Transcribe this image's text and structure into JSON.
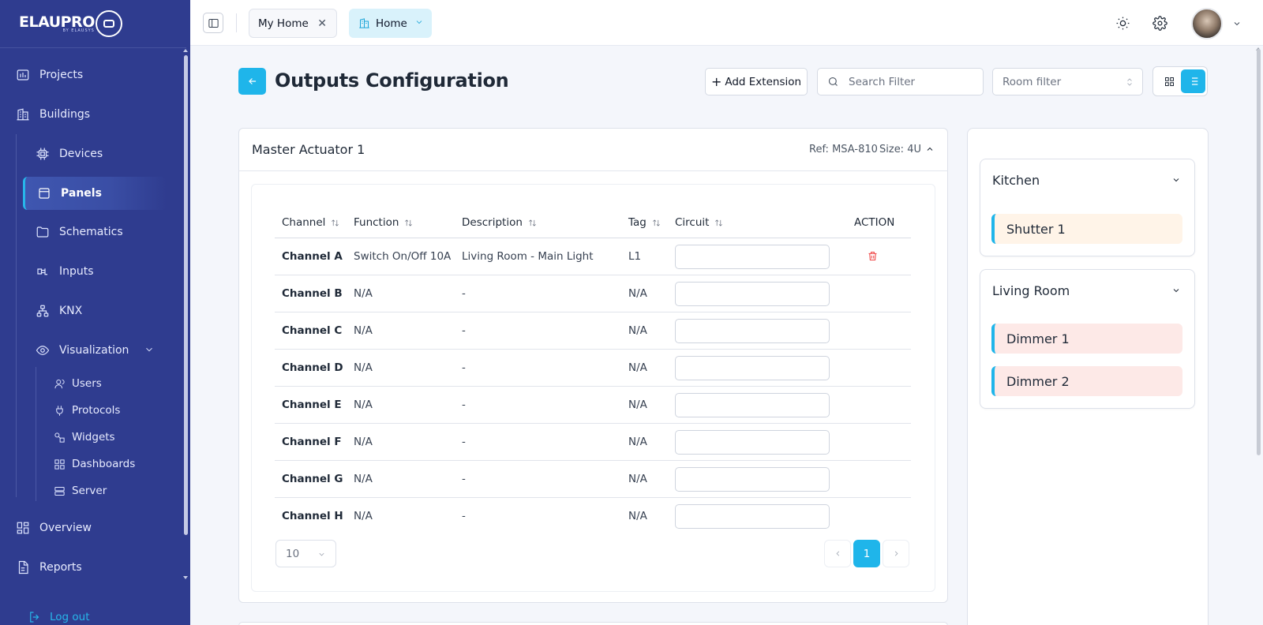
{
  "sidebar": {
    "logo": {
      "name": "ELAUPRO",
      "sub": "BY ELAUSYS"
    },
    "items": {
      "projects": "Projects",
      "buildings": "Buildings",
      "devices": "Devices",
      "panels": "Panels",
      "schematics": "Schematics",
      "inputs": "Inputs",
      "knx": "KNX",
      "visualization": "Visualization",
      "users": "Users",
      "protocols": "Protocols",
      "widgets": "Widgets",
      "dashboards": "Dashboards",
      "server": "Server",
      "overview": "Overview",
      "reports": "Reports"
    },
    "logout": "Log out",
    "active_item": "Panels"
  },
  "topbar": {
    "tabs": [
      {
        "label": "My Home",
        "closable": true
      },
      {
        "label": "Home",
        "icon": "building-icon",
        "dropdown": true
      }
    ]
  },
  "page": {
    "title": "Outputs Configuration",
    "add_extension": "Add Extension",
    "search_placeholder": "Search Filter",
    "room_filter_placeholder": "Room filter",
    "view_mode": "list"
  },
  "actuator": {
    "name": "Master Actuator 1",
    "ref": "Ref: MSA-810",
    "size": "Size: 4U",
    "columns": [
      "Channel",
      "Function",
      "Description",
      "Tag",
      "Circuit",
      "ACTION"
    ],
    "rows": [
      {
        "channel": "Channel A",
        "function": "Switch On/Off 10A",
        "description": "Living Room - Main Light",
        "tag": "L1",
        "circuit": "",
        "deletable": true
      },
      {
        "channel": "Channel B",
        "function": "N/A",
        "description": "-",
        "tag": "N/A",
        "circuit": "",
        "deletable": false
      },
      {
        "channel": "Channel C",
        "function": "N/A",
        "description": "-",
        "tag": "N/A",
        "circuit": "",
        "deletable": false
      },
      {
        "channel": "Channel D",
        "function": "N/A",
        "description": "-",
        "tag": "N/A",
        "circuit": "",
        "deletable": false
      },
      {
        "channel": "Channel E",
        "function": "N/A",
        "description": "-",
        "tag": "N/A",
        "circuit": "",
        "deletable": false
      },
      {
        "channel": "Channel F",
        "function": "N/A",
        "description": "-",
        "tag": "N/A",
        "circuit": "",
        "deletable": false
      },
      {
        "channel": "Channel G",
        "function": "N/A",
        "description": "-",
        "tag": "N/A",
        "circuit": "",
        "deletable": false
      },
      {
        "channel": "Channel H",
        "function": "N/A",
        "description": "-",
        "tag": "N/A",
        "circuit": "",
        "deletable": false
      }
    ],
    "page_size": "10",
    "current_page": "1"
  },
  "rooms": [
    {
      "name": "Kitchen",
      "devices": [
        {
          "name": "Shutter 1",
          "type": "shutter"
        }
      ]
    },
    {
      "name": "Living Room",
      "devices": [
        {
          "name": "Dimmer 1",
          "type": "dimmer"
        },
        {
          "name": "Dimmer 2",
          "type": "dimmer"
        }
      ]
    }
  ],
  "colors": {
    "sidebar_bg": "#2f3c8f",
    "accent": "#1fb5ea",
    "danger": "#ef4444",
    "shutter_bg": "#fff4e8",
    "dimmer_bg": "#fde9e7"
  }
}
